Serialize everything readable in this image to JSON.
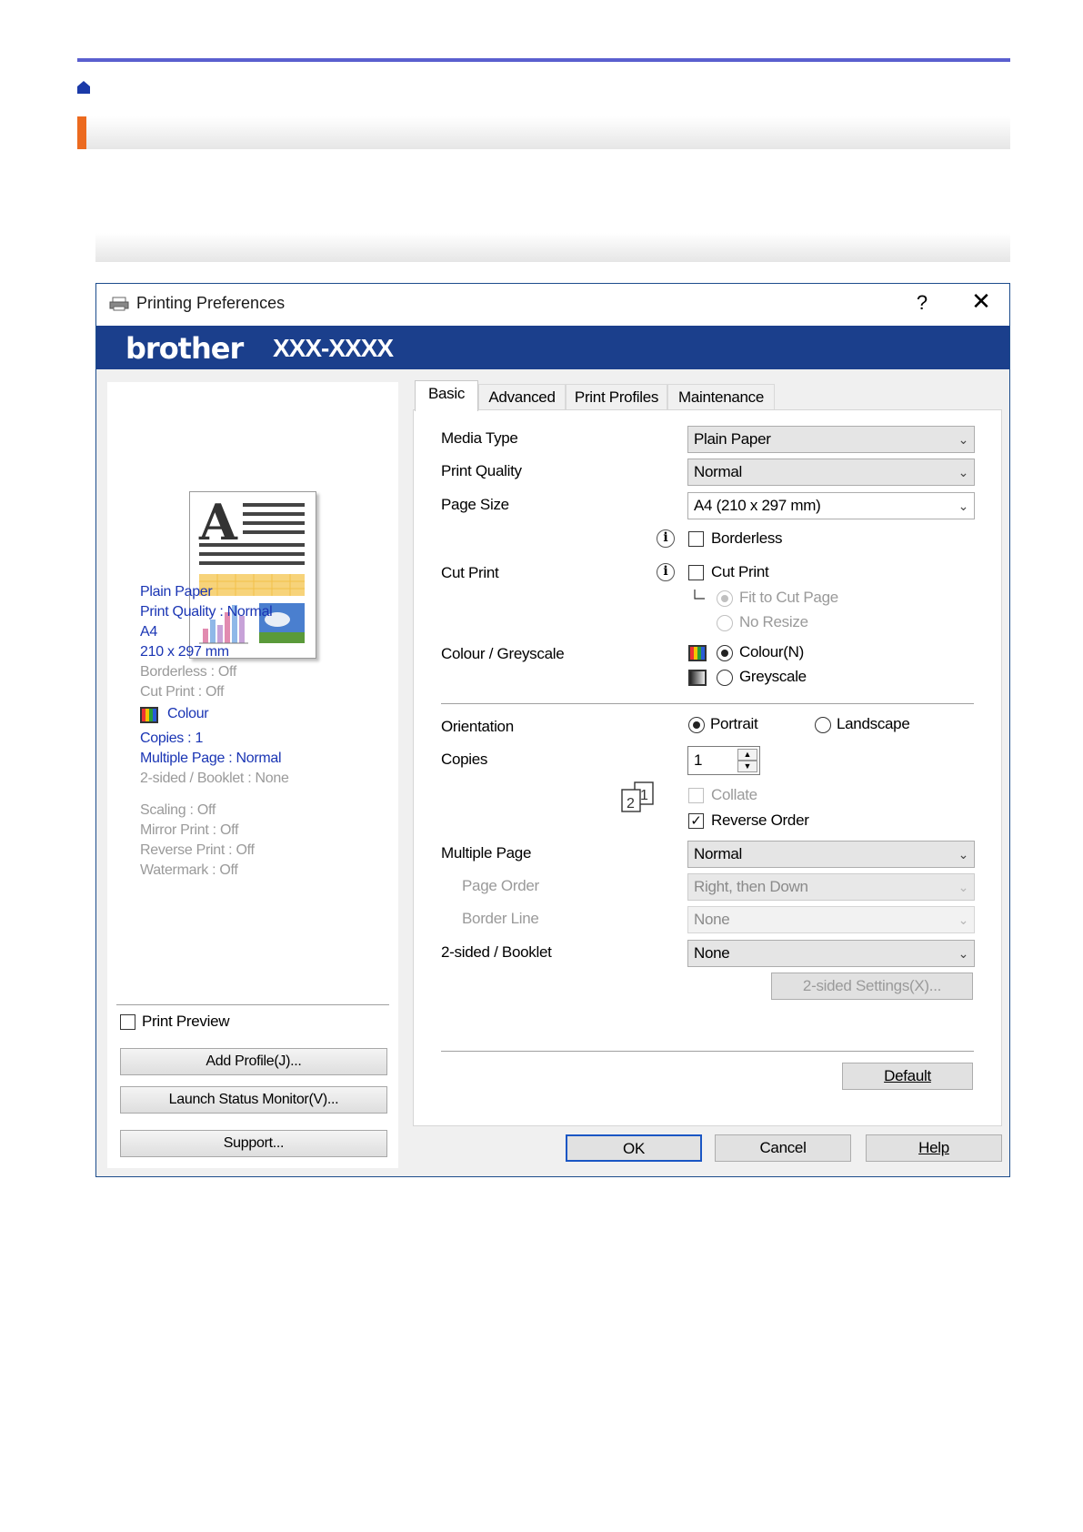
{
  "dialog": {
    "title": "Printing Preferences",
    "help_glyph": "?",
    "close_glyph": "✕",
    "brand": "brother",
    "model": "XXX-XXXX"
  },
  "summary": {
    "items": [
      {
        "text": "Plain Paper",
        "active": true
      },
      {
        "text": "Print Quality : Normal",
        "active": true
      },
      {
        "text": "A4",
        "active": true
      },
      {
        "text": "210 x 297 mm",
        "active": true
      },
      {
        "text": "Borderless : Off",
        "active": false
      },
      {
        "text": "Cut Print : Off",
        "active": false
      },
      {
        "text": "Colour",
        "active": true
      },
      {
        "text": "Copies : 1",
        "active": true
      },
      {
        "text": "Multiple Page : Normal",
        "active": true
      },
      {
        "text": "2-sided / Booklet : None",
        "active": false
      },
      {
        "text": "Scaling : Off",
        "active": false
      },
      {
        "text": "Mirror Print : Off",
        "active": false
      },
      {
        "text": "Reverse Print : Off",
        "active": false
      },
      {
        "text": "Watermark : Off",
        "active": false
      }
    ],
    "print_preview_label": "Print Preview",
    "add_profile_button": "Add Profile(J)...",
    "launch_status_button": "Launch Status Monitor(V)...",
    "support_button": "Support..."
  },
  "tabs": [
    "Basic",
    "Advanced",
    "Print Profiles",
    "Maintenance"
  ],
  "basic": {
    "media_type_label": "Media Type",
    "media_type_value": "Plain Paper",
    "print_quality_label": "Print Quality",
    "print_quality_value": "Normal",
    "page_size_label": "Page Size",
    "page_size_value": "A4 (210 x 297 mm)",
    "borderless_label": "Borderless",
    "cut_print_label": "Cut Print",
    "cut_print_checkbox": "Cut Print",
    "fit_to_cut_page": "Fit to Cut Page",
    "no_resize": "No Resize",
    "colour_label": "Colour / Greyscale",
    "colour_option": "Colour(N)",
    "greyscale_option": "Greyscale",
    "orientation_label": "Orientation",
    "portrait": "Portrait",
    "landscape": "Landscape",
    "copies_label": "Copies",
    "copies_value": "1",
    "collate": "Collate",
    "reverse_order": "Reverse Order",
    "multiple_page_label": "Multiple Page",
    "multiple_page_value": "Normal",
    "page_order_label": "Page Order",
    "page_order_value": "Right, then Down",
    "border_line_label": "Border Line",
    "border_line_value": "None",
    "two_sided_label": "2-sided / Booklet",
    "two_sided_value": "None",
    "two_sided_settings_button": "2-sided Settings(X)...",
    "default_button": "Default"
  },
  "footer": {
    "ok": "OK",
    "cancel": "Cancel",
    "help": "Help"
  },
  "colors": {
    "accent_rule": "#5a5fcf",
    "title_accent": "#ec6a1f",
    "brand_bar": "#1b3f8c",
    "summary_active": "#1a35b4"
  }
}
